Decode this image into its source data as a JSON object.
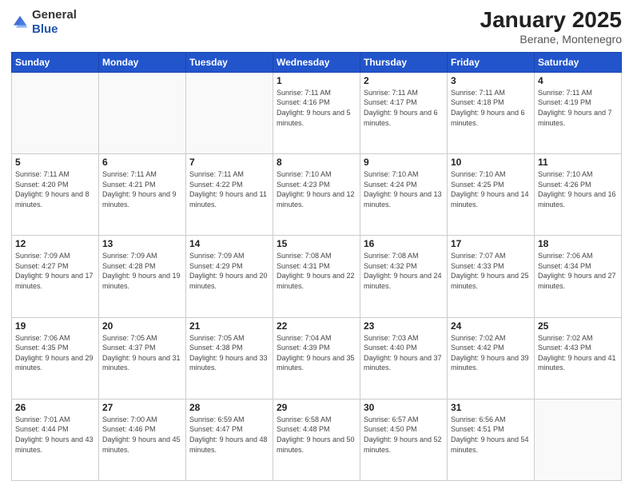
{
  "logo": {
    "general": "General",
    "blue": "Blue"
  },
  "title": {
    "month": "January 2025",
    "location": "Berane, Montenegro"
  },
  "weekdays": [
    "Sunday",
    "Monday",
    "Tuesday",
    "Wednesday",
    "Thursday",
    "Friday",
    "Saturday"
  ],
  "weeks": [
    [
      {
        "day": "",
        "info": ""
      },
      {
        "day": "",
        "info": ""
      },
      {
        "day": "",
        "info": ""
      },
      {
        "day": "1",
        "info": "Sunrise: 7:11 AM\nSunset: 4:16 PM\nDaylight: 9 hours and 5 minutes."
      },
      {
        "day": "2",
        "info": "Sunrise: 7:11 AM\nSunset: 4:17 PM\nDaylight: 9 hours and 6 minutes."
      },
      {
        "day": "3",
        "info": "Sunrise: 7:11 AM\nSunset: 4:18 PM\nDaylight: 9 hours and 6 minutes."
      },
      {
        "day": "4",
        "info": "Sunrise: 7:11 AM\nSunset: 4:19 PM\nDaylight: 9 hours and 7 minutes."
      }
    ],
    [
      {
        "day": "5",
        "info": "Sunrise: 7:11 AM\nSunset: 4:20 PM\nDaylight: 9 hours and 8 minutes."
      },
      {
        "day": "6",
        "info": "Sunrise: 7:11 AM\nSunset: 4:21 PM\nDaylight: 9 hours and 9 minutes."
      },
      {
        "day": "7",
        "info": "Sunrise: 7:11 AM\nSunset: 4:22 PM\nDaylight: 9 hours and 11 minutes."
      },
      {
        "day": "8",
        "info": "Sunrise: 7:10 AM\nSunset: 4:23 PM\nDaylight: 9 hours and 12 minutes."
      },
      {
        "day": "9",
        "info": "Sunrise: 7:10 AM\nSunset: 4:24 PM\nDaylight: 9 hours and 13 minutes."
      },
      {
        "day": "10",
        "info": "Sunrise: 7:10 AM\nSunset: 4:25 PM\nDaylight: 9 hours and 14 minutes."
      },
      {
        "day": "11",
        "info": "Sunrise: 7:10 AM\nSunset: 4:26 PM\nDaylight: 9 hours and 16 minutes."
      }
    ],
    [
      {
        "day": "12",
        "info": "Sunrise: 7:09 AM\nSunset: 4:27 PM\nDaylight: 9 hours and 17 minutes."
      },
      {
        "day": "13",
        "info": "Sunrise: 7:09 AM\nSunset: 4:28 PM\nDaylight: 9 hours and 19 minutes."
      },
      {
        "day": "14",
        "info": "Sunrise: 7:09 AM\nSunset: 4:29 PM\nDaylight: 9 hours and 20 minutes."
      },
      {
        "day": "15",
        "info": "Sunrise: 7:08 AM\nSunset: 4:31 PM\nDaylight: 9 hours and 22 minutes."
      },
      {
        "day": "16",
        "info": "Sunrise: 7:08 AM\nSunset: 4:32 PM\nDaylight: 9 hours and 24 minutes."
      },
      {
        "day": "17",
        "info": "Sunrise: 7:07 AM\nSunset: 4:33 PM\nDaylight: 9 hours and 25 minutes."
      },
      {
        "day": "18",
        "info": "Sunrise: 7:06 AM\nSunset: 4:34 PM\nDaylight: 9 hours and 27 minutes."
      }
    ],
    [
      {
        "day": "19",
        "info": "Sunrise: 7:06 AM\nSunset: 4:35 PM\nDaylight: 9 hours and 29 minutes."
      },
      {
        "day": "20",
        "info": "Sunrise: 7:05 AM\nSunset: 4:37 PM\nDaylight: 9 hours and 31 minutes."
      },
      {
        "day": "21",
        "info": "Sunrise: 7:05 AM\nSunset: 4:38 PM\nDaylight: 9 hours and 33 minutes."
      },
      {
        "day": "22",
        "info": "Sunrise: 7:04 AM\nSunset: 4:39 PM\nDaylight: 9 hours and 35 minutes."
      },
      {
        "day": "23",
        "info": "Sunrise: 7:03 AM\nSunset: 4:40 PM\nDaylight: 9 hours and 37 minutes."
      },
      {
        "day": "24",
        "info": "Sunrise: 7:02 AM\nSunset: 4:42 PM\nDaylight: 9 hours and 39 minutes."
      },
      {
        "day": "25",
        "info": "Sunrise: 7:02 AM\nSunset: 4:43 PM\nDaylight: 9 hours and 41 minutes."
      }
    ],
    [
      {
        "day": "26",
        "info": "Sunrise: 7:01 AM\nSunset: 4:44 PM\nDaylight: 9 hours and 43 minutes."
      },
      {
        "day": "27",
        "info": "Sunrise: 7:00 AM\nSunset: 4:46 PM\nDaylight: 9 hours and 45 minutes."
      },
      {
        "day": "28",
        "info": "Sunrise: 6:59 AM\nSunset: 4:47 PM\nDaylight: 9 hours and 48 minutes."
      },
      {
        "day": "29",
        "info": "Sunrise: 6:58 AM\nSunset: 4:48 PM\nDaylight: 9 hours and 50 minutes."
      },
      {
        "day": "30",
        "info": "Sunrise: 6:57 AM\nSunset: 4:50 PM\nDaylight: 9 hours and 52 minutes."
      },
      {
        "day": "31",
        "info": "Sunrise: 6:56 AM\nSunset: 4:51 PM\nDaylight: 9 hours and 54 minutes."
      },
      {
        "day": "",
        "info": ""
      }
    ]
  ]
}
